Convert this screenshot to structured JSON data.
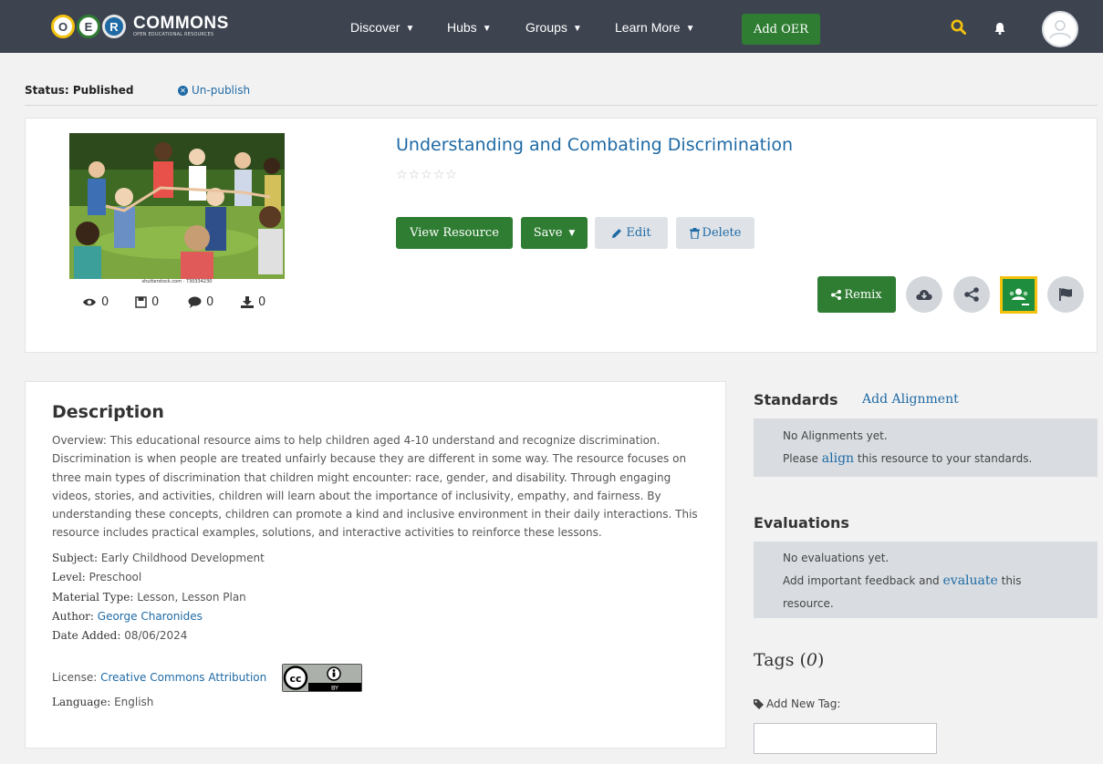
{
  "header": {
    "logo_letters": [
      "O",
      "E",
      "R"
    ],
    "logo_title": "COMMONS",
    "logo_subtitle": "OPEN EDUCATIONAL RESOURCES",
    "nav": [
      {
        "label": "Discover"
      },
      {
        "label": "Hubs"
      },
      {
        "label": "Groups"
      },
      {
        "label": "Learn More"
      }
    ],
    "add_oer_label": "Add OER",
    "icons": [
      "search-icon",
      "bell-icon",
      "avatar-icon"
    ],
    "colors": {
      "bar": "#3d4450",
      "accent_green": "#2e7d32",
      "search": "#f4c20d",
      "link": "#1f6aa5"
    }
  },
  "status": {
    "label": "Status: Published",
    "unpublish_label": "Un-publish"
  },
  "resource": {
    "title": "Understanding and Combating Discrimination",
    "rating": 0,
    "rating_max": 5,
    "image_caption": "shutterstock.com · 730334230",
    "stats": {
      "views": "0",
      "saves": "0",
      "comments": "0",
      "downloads": "0"
    },
    "buttons": {
      "view": "View Resource",
      "save": "Save",
      "edit": "Edit",
      "delete": "Delete",
      "remix": "Remix"
    }
  },
  "description": {
    "heading": "Description",
    "overview": "Overview: This educational resource aims to help children aged 4-10 understand and recognize discrimination. Discrimination is when people are treated unfairly because they are different in some way. The resource focuses on three main types of discrimination that children might encounter: race, gender, and disability. Through engaging videos, stories, and activities, children will learn about the importance of inclusivity, empathy, and fairness. By understanding these concepts, children can promote a kind and inclusive environment in their daily interactions. This resource includes practical examples, solutions, and interactive activities to reinforce these lessons.",
    "subject_label": "Subject:",
    "subject": "Early Childhood Development",
    "level_label": "Level:",
    "level": "Preschool",
    "material_label": "Material Type:",
    "material": "Lesson, Lesson Plan",
    "author_label": "Author:",
    "author": "George Charonides",
    "date_label": "Date Added:",
    "date": "08/06/2024",
    "license_label": "License:",
    "license": "Creative Commons Attribution",
    "license_badge_text": "BY",
    "language_label": "Language:",
    "language": "English"
  },
  "standards": {
    "heading": "Standards",
    "add_label": "Add Alignment",
    "line1": "No Alignments yet.",
    "line2_pre": "Please",
    "line2_link": "align",
    "line2_post": "this resource to your standards."
  },
  "evaluations": {
    "heading": "Evaluations",
    "line1": "No evaluations yet.",
    "line2_pre": "Add important feedback and",
    "line2_link": "evaluate",
    "line2_post": "this",
    "line3": "resource."
  },
  "tags": {
    "heading": "Tags",
    "count": "0",
    "add_label": "Add New Tag:",
    "input_value": ""
  }
}
